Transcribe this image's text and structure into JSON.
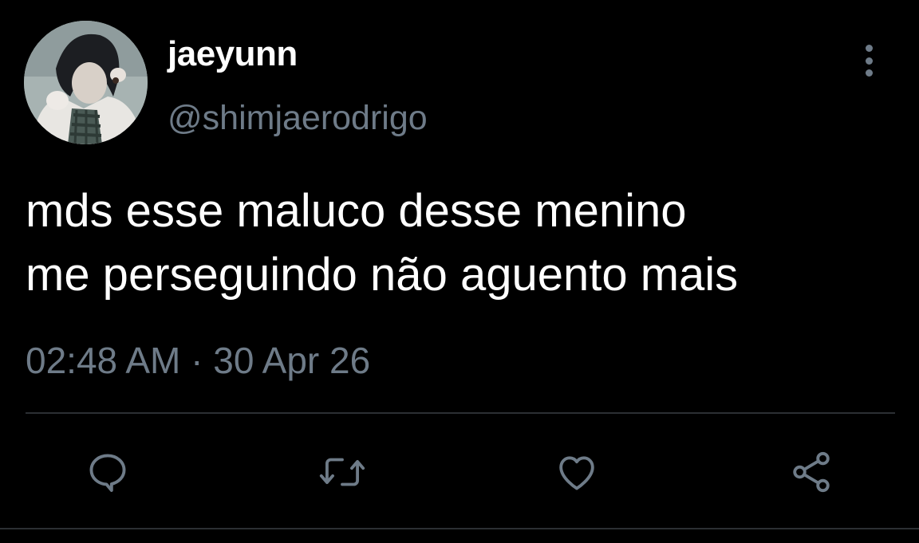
{
  "user": {
    "display_name": "jaeyunn",
    "handle": "@shimjaerodrigo",
    "avatar_icon": "profile-photo"
  },
  "tweet": {
    "text_lines": [
      "mds esse maluco desse menino",
      "me perseguindo não aguento mais"
    ],
    "time": "02:48 AM",
    "separator": "·",
    "date": "30 Apr 26"
  },
  "actions": {
    "reply_icon": "reply-icon",
    "retweet_icon": "retweet-icon",
    "like_icon": "heart-icon",
    "share_icon": "share-icon"
  },
  "colors": {
    "background": "#000000",
    "primary_text": "#ffffff",
    "secondary_text": "#6e7b88",
    "divider": "#2b2f33"
  }
}
